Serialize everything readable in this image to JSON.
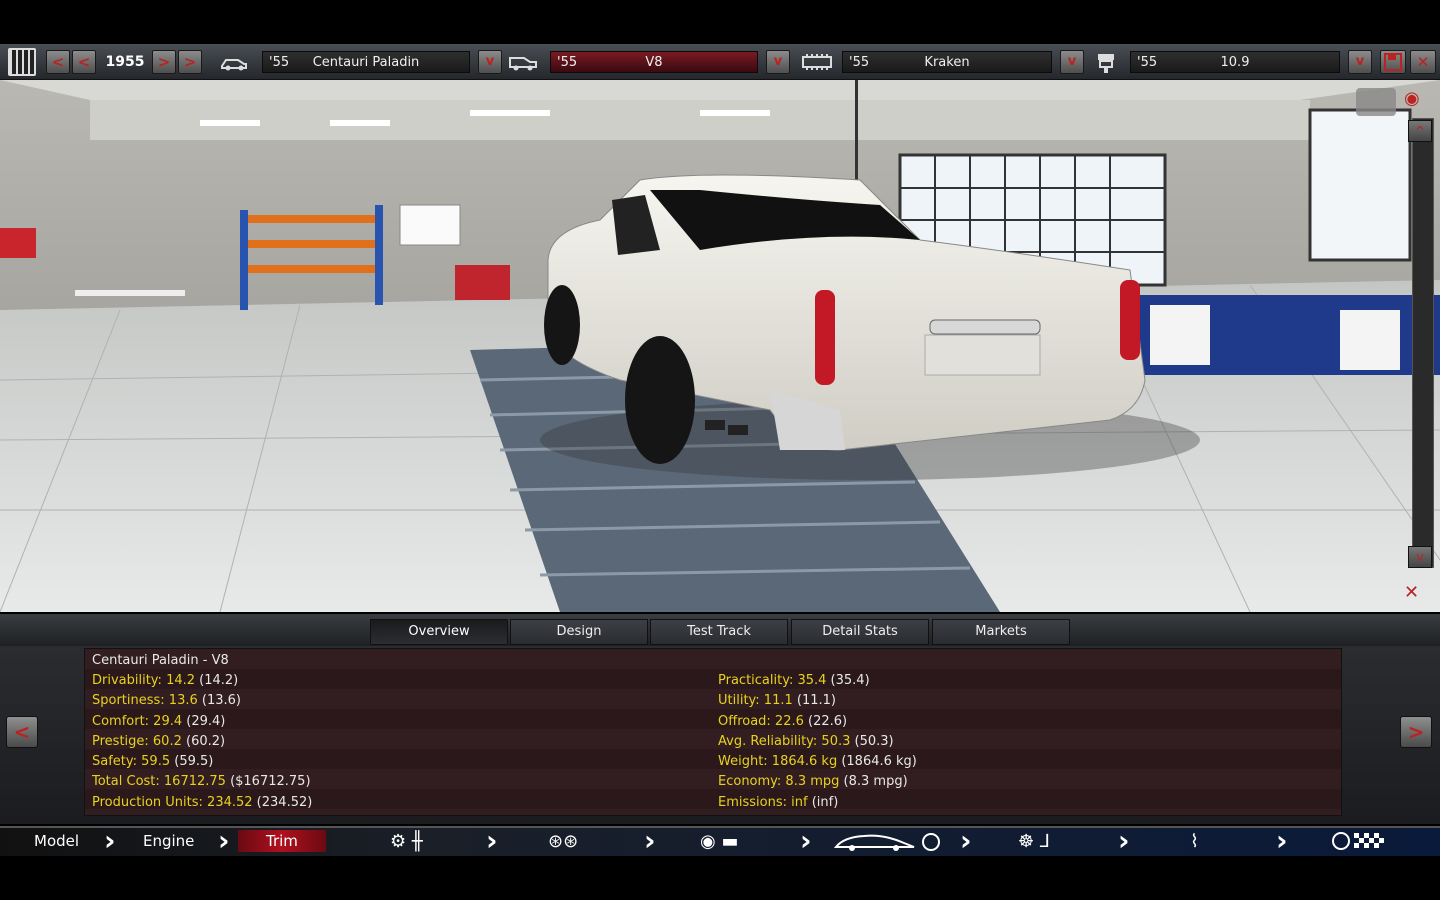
{
  "toolbar": {
    "year": "1955",
    "prev_label": "<",
    "next_label": ">",
    "model": {
      "year": "'55",
      "name": "Centauri Paladin"
    },
    "engine": {
      "year": "'55",
      "name": "V8"
    },
    "trim": {
      "year": "'55",
      "name": "Kraken"
    },
    "trim2": {
      "year": "'55",
      "name": "10.9"
    },
    "dropdown_label": "v"
  },
  "viewer": {
    "scroll_up": "^",
    "scroll_down": "v"
  },
  "tabs": [
    "Overview",
    "Design",
    "Test Track",
    "Detail Stats",
    "Markets"
  ],
  "overview": {
    "title": "Centauri Paladin - V8",
    "left": [
      {
        "k": "Drivability: 14.2",
        "v": " (14.2)"
      },
      {
        "k": "Sportiness: 13.6",
        "v": " (13.6)"
      },
      {
        "k": "Comfort: 29.4",
        "v": " (29.4)"
      },
      {
        "k": "Prestige: 60.2",
        "v": " (60.2)"
      },
      {
        "k": "Safety: 59.5",
        "v": " (59.5)"
      },
      {
        "k": "Total Cost: 16712.75",
        "v": " ($16712.75)"
      },
      {
        "k": "Production Units: 234.52",
        "v": " (234.52)"
      }
    ],
    "right": [
      {
        "k": "Practicality: 35.4",
        "v": " (35.4)"
      },
      {
        "k": "Utility: 11.1",
        "v": " (11.1)"
      },
      {
        "k": "Offroad: 22.6",
        "v": " (22.6)"
      },
      {
        "k": "Avg. Reliability: 50.3",
        "v": " (50.3)"
      },
      {
        "k": "Weight: 1864.6 kg",
        "v": " (1864.6 kg)"
      },
      {
        "k": "Economy: 8.3 mpg",
        "v": " (8.3 mpg)"
      },
      {
        "k": "Emissions: inf",
        "v": " (inf)"
      }
    ]
  },
  "stages": {
    "model": "Model",
    "engine": "Engine",
    "trim": "Trim"
  },
  "colors": {
    "accent": "#b0101e",
    "stat_key": "#e8d21e"
  }
}
